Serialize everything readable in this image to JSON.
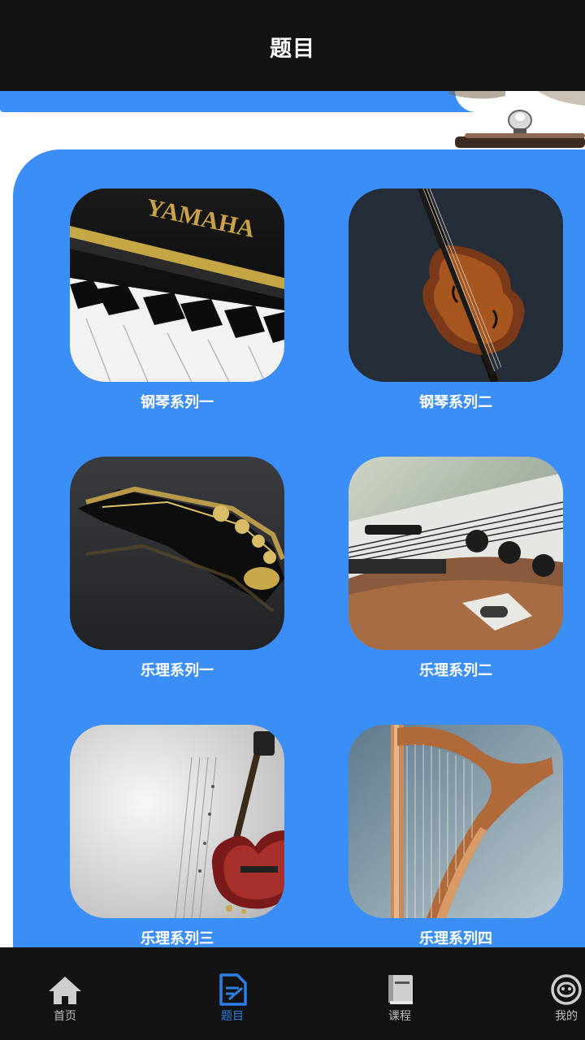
{
  "header": {
    "title": "题目"
  },
  "tiles": [
    {
      "label": "钢琴系列一",
      "image": "piano-keys-image",
      "image_text": "YAMAHA"
    },
    {
      "label": "钢琴系列二",
      "image": "violin-image"
    },
    {
      "label": "乐理系列一",
      "image": "saxophone-image"
    },
    {
      "label": "乐理系列二",
      "image": "electric-guitar-image"
    },
    {
      "label": "乐理系列三",
      "image": "guitar-sheet-music-image"
    },
    {
      "label": "乐理系列四",
      "image": "harp-image"
    }
  ],
  "nav": [
    {
      "label": "首页",
      "icon": "home-icon",
      "active": false
    },
    {
      "label": "题目",
      "icon": "document-edit-icon",
      "active": true
    },
    {
      "label": "课程",
      "icon": "book-icon",
      "active": false
    },
    {
      "label": "我的",
      "icon": "profile-icon",
      "active": false
    }
  ],
  "colors": {
    "bar": "#131313",
    "accent": "#3a8ef5",
    "active": "#2d7fe8",
    "inactive": "#bdbdbd"
  }
}
